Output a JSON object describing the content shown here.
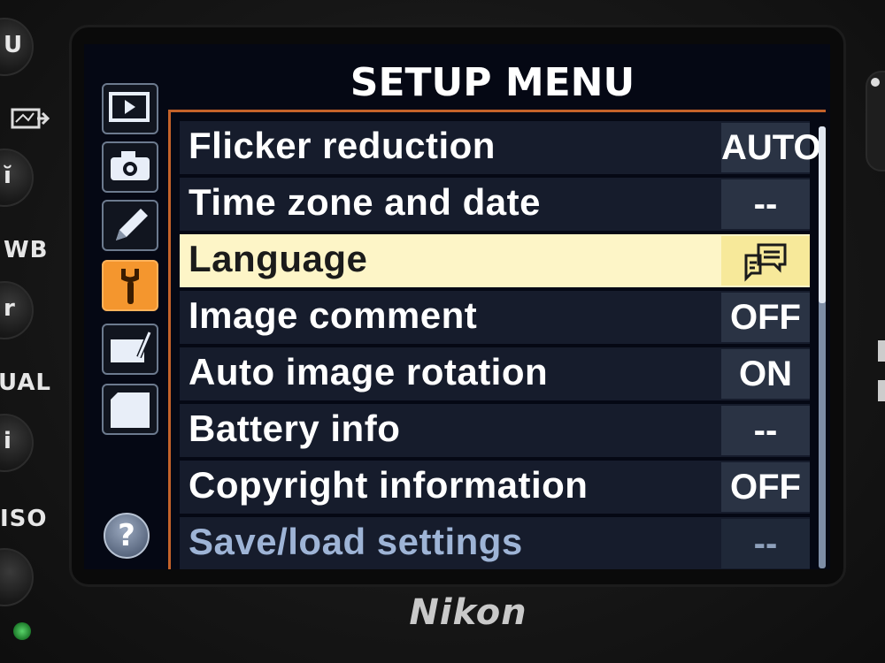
{
  "camera": {
    "brand": "Nikon",
    "side_labels": [
      "WB",
      "UAL",
      "ISO"
    ],
    "side_buttons": [
      "U",
      "ĭ",
      "r",
      "i"
    ]
  },
  "screen": {
    "title": "SETUP MENU",
    "tabs": [
      {
        "name": "playback",
        "active": false
      },
      {
        "name": "shooting",
        "active": false
      },
      {
        "name": "custom-settings",
        "active": false
      },
      {
        "name": "setup",
        "active": true
      },
      {
        "name": "retouch",
        "active": false
      },
      {
        "name": "my-menu",
        "active": false
      }
    ],
    "help_label": "?",
    "items": [
      {
        "label": "Flicker reduction",
        "value": "AUTO"
      },
      {
        "label": "Time zone and date",
        "value": "--"
      },
      {
        "label": "Language",
        "value": "",
        "selected": true,
        "value_icon": "language-speech-bubble-icon"
      },
      {
        "label": "Image comment",
        "value": "OFF"
      },
      {
        "label": "Auto image rotation",
        "value": "ON"
      },
      {
        "label": "Battery info",
        "value": "--"
      },
      {
        "label": "Copyright information",
        "value": "OFF"
      },
      {
        "label": "Save/load settings",
        "value": "--",
        "dimmed": true
      }
    ],
    "scroll_position": 0,
    "colors": {
      "selected_row": "#fdf5c7",
      "active_tab": "#f4962e",
      "accent_line": "#c4622a"
    }
  }
}
